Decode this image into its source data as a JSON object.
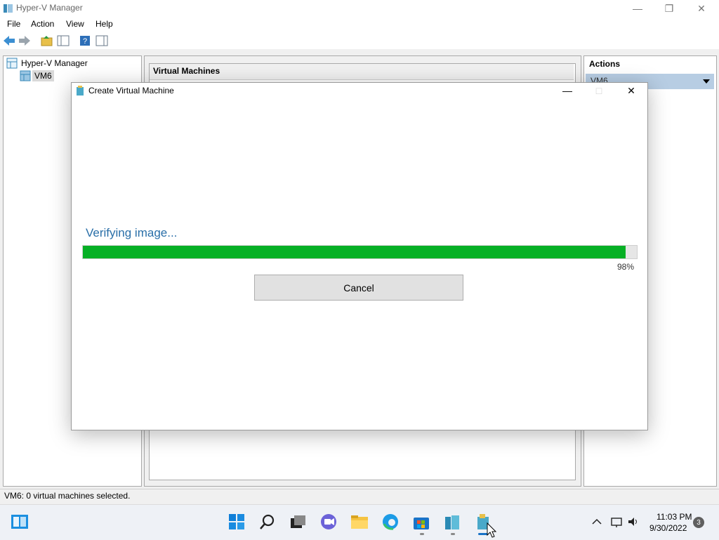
{
  "window": {
    "title": "Hyper-V Manager",
    "menu": [
      "File",
      "Action",
      "View",
      "Help"
    ]
  },
  "tree": {
    "root": "Hyper-V Manager",
    "child": "VM6"
  },
  "center": {
    "header": "Virtual Machines"
  },
  "actions": {
    "title": "Actions",
    "selected": "VM6"
  },
  "status_bar": {
    "text": "VM6:  0 virtual machines selected."
  },
  "dialog": {
    "title": "Create Virtual Machine",
    "message": "Verifying image...",
    "progress_value": 98,
    "progress_label": "98%",
    "cancel_label": "Cancel"
  },
  "taskbar": {
    "icons": [
      "windows-start-icon",
      "search-icon",
      "task-view-icon",
      "chat-icon",
      "file-explorer-icon",
      "edge-browser-icon",
      "microsoft-store-icon",
      "hyper-v-manager-icon",
      "create-vm-icon"
    ],
    "time": "11:03 PM",
    "date": "9/30/2022",
    "notification_count": "3"
  },
  "colors": {
    "progress_fill": "#06b025",
    "accent_text": "#2a6fa8",
    "selection": "#b7cde3"
  }
}
